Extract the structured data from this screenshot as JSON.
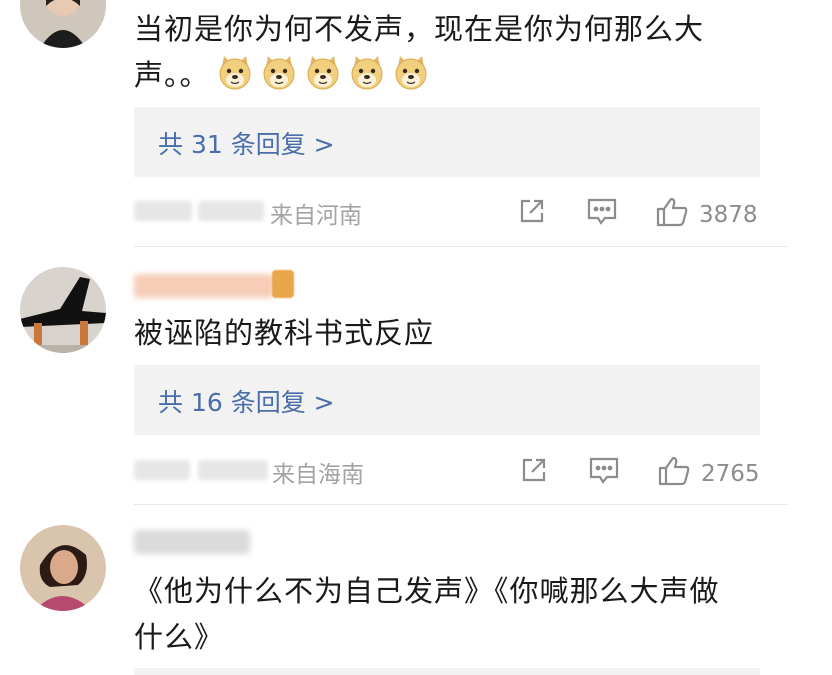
{
  "comments": [
    {
      "text_line1": "当初是你为何不发声，现在是你为何那么大",
      "text_line2": "声。。",
      "emoji_count": 5,
      "emoji_icon": "doge-emoji-icon",
      "replies_label": "共 31 条回复 >",
      "location": "来自河南",
      "likes": "3878"
    },
    {
      "text": "被诬陷的教科书式反应",
      "replies_label": "共 16 条回复 >",
      "location": "来自海南",
      "likes": "2765"
    },
    {
      "text_line1": "《他为什么不为自己发声》《你喊那么大声做",
      "text_line2": "什么》"
    }
  ],
  "icons": {
    "share": "share-icon",
    "comment": "comment-icon",
    "like": "thumbs-up-icon"
  },
  "colors": {
    "link": "#4a6ea9",
    "meta": "#a3a3a3",
    "reply_bg": "#f2f2f2"
  }
}
